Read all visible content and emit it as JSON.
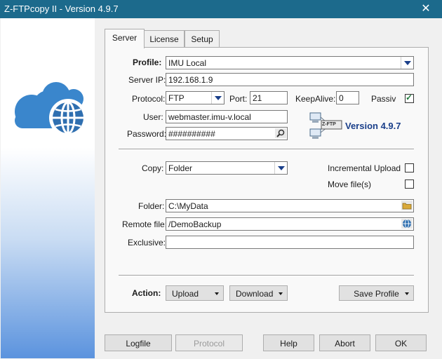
{
  "window": {
    "title": "Z-FTPcopy II - Version 4.9.7",
    "close_glyph": "✕"
  },
  "tabs": [
    {
      "label": "Server"
    },
    {
      "label": "License"
    },
    {
      "label": "Setup"
    }
  ],
  "form": {
    "profile_label": "Profile:",
    "profile_value": "IMU Local",
    "server_ip_label": "Server IP:",
    "server_ip_value": "192.168.1.9",
    "protocol_label": "Protocol:",
    "protocol_value": "FTP",
    "port_label": "Port:",
    "port_value": "21",
    "keepalive_label": "KeepAlive:",
    "keepalive_value": "0",
    "passiv_label": "Passiv",
    "passiv_checked": true,
    "user_label": "User:",
    "user_value": "webmaster.imu-v.local",
    "password_label": "Password:",
    "password_value": "##########",
    "version_text": "Version 4.9.7",
    "logo_badge": "Z-FTP",
    "copy_label": "Copy:",
    "copy_value": "Folder",
    "incremental_label": "Incremental Upload",
    "incremental_checked": false,
    "move_label": "Move file(s)",
    "move_checked": false,
    "folder_label": "Folder:",
    "folder_value": "C:\\MyData",
    "remote_label": "Remote file:",
    "remote_value": "/DemoBackup",
    "exclusive_label": "Exclusive:",
    "exclusive_value": "",
    "action_label": "Action:",
    "upload_label": "Upload",
    "download_label": "Download",
    "save_profile_label": "Save Profile"
  },
  "bottom": {
    "logfile": "Logfile",
    "protocol": "Protocol",
    "help": "Help",
    "abort": "Abort",
    "ok": "OK"
  },
  "colors": {
    "titlebar": "#1c6a8c",
    "cloud": "#3a86cc",
    "version": "#1a3f8a"
  },
  "icons": {
    "cloud": "cloud-globe-icon",
    "search": "search-icon",
    "folder": "folder-icon",
    "globe": "globe-icon"
  }
}
